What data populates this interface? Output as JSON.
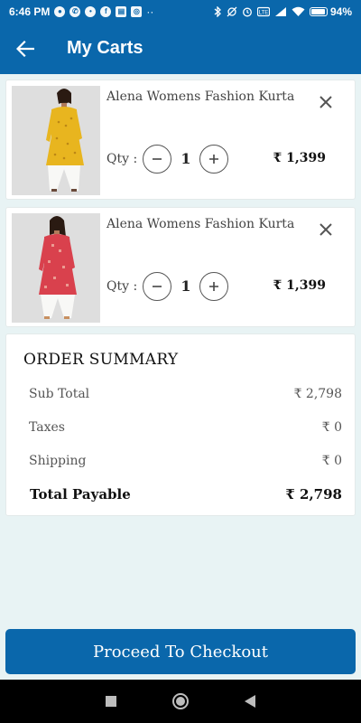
{
  "status_bar": {
    "time": "6:46 PM",
    "battery": "94%",
    "battery_level": 0.94,
    "icons_left": [
      "message-icon",
      "whatsapp-icon",
      "user-icon",
      "facebook-icon",
      "news-icon",
      "instagram-icon",
      "more-dots-icon"
    ],
    "icons_right": [
      "bluetooth-icon",
      "mute-icon",
      "alarm-icon",
      "volte-icon",
      "signal-icon",
      "wifi-icon",
      "battery-icon"
    ]
  },
  "app_bar": {
    "title": "My Carts",
    "back_icon": "arrow-left-icon"
  },
  "cart": {
    "items": [
      {
        "name": "Alena Womens Fashion Kurta",
        "qty_label": "Qty :",
        "quantity": "1",
        "price": "₹ 1,399",
        "color": "#e8b51f"
      },
      {
        "name": "Alena Womens Fashion Kurta",
        "qty_label": "Qty :",
        "quantity": "1",
        "price": "₹ 1,399",
        "color": "#d9414d"
      }
    ]
  },
  "summary": {
    "title": "ORDER SUMMARY",
    "rows": [
      {
        "label": "Sub Total",
        "value": "₹ 2,798"
      },
      {
        "label": "Taxes",
        "value": "₹ 0"
      },
      {
        "label": "Shipping",
        "value": "₹ 0"
      }
    ],
    "total": {
      "label": "Total Payable",
      "value": "₹ 2,798"
    }
  },
  "checkout_label": "Proceed To Checkout",
  "nav": [
    "recents-icon",
    "home-icon",
    "back-triangle-icon"
  ],
  "colors": {
    "primary": "#0a67ab",
    "background": "#e8f3f4"
  }
}
